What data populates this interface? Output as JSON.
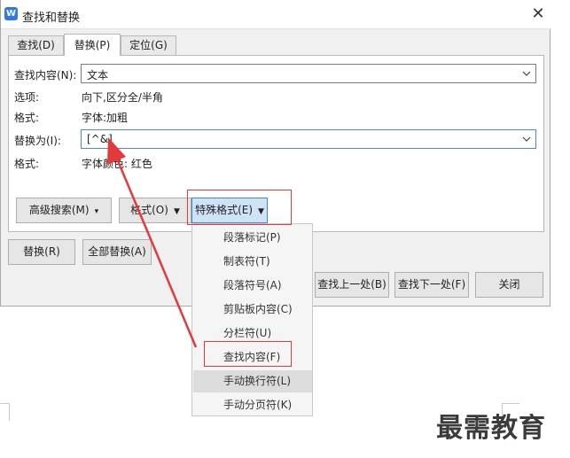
{
  "window": {
    "title": "查找和替换",
    "app_icon_letter": "W",
    "close_glyph": "✕"
  },
  "tabs": [
    {
      "label": "查找(D)",
      "active": false
    },
    {
      "label": "替换(P)",
      "active": true
    },
    {
      "label": "定位(G)",
      "active": false
    }
  ],
  "find": {
    "label": "查找内容(N):",
    "value": "文本"
  },
  "options": {
    "label": "选项:",
    "value": "向下,区分全/半角"
  },
  "find_format": {
    "label": "格式:",
    "value": "字体:加粗"
  },
  "replace": {
    "label": "替换为(I):",
    "value": "[^&]"
  },
  "replace_format": {
    "label": "格式:",
    "value": "字体颜色: 红色"
  },
  "buttons": {
    "advanced_search": "高级搜索(M)",
    "format": "格式(O)",
    "special_format": "特殊格式(E)",
    "replace": "替换(R)",
    "replace_all": "全部替换(A)",
    "find_prev": "查找上一处(B)",
    "find_next": "查找下一处(F)",
    "close": "关闭"
  },
  "special_menu": [
    "段落标记(P)",
    "制表符(T)",
    "段落符号(A)",
    "剪贴板内容(C)",
    "分栏符(U)",
    "查找内容(F)",
    "手动换行符(L)",
    "手动分页符(K)"
  ],
  "highlighted_menu_index": 6,
  "watermark": "最需教育",
  "colors": {
    "accent": "#2f7ae5",
    "annotation": "#e5383b",
    "menu_highlight": "#dcdcdc"
  }
}
